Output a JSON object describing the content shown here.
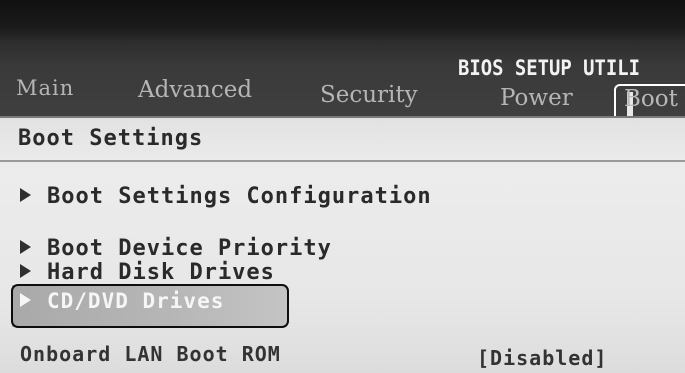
{
  "header": {
    "title": "BIOS SETUP UTILI",
    "tabs": [
      {
        "label": "Main"
      },
      {
        "label": "Advanced"
      },
      {
        "label": "Security"
      },
      {
        "label": "Power"
      },
      {
        "label": "Boot"
      }
    ],
    "active_tab": "Boot"
  },
  "section": {
    "title": "Boot Settings"
  },
  "menu": {
    "items": [
      {
        "label": "Boot Settings Configuration"
      },
      {
        "label": "Boot Device Priority"
      },
      {
        "label": "Hard Disk Drives"
      },
      {
        "label": "CD/DVD Drives"
      }
    ],
    "selected": "CD/DVD Drives"
  },
  "settings": {
    "onboard_lan_label": "Onboard LAN Boot ROM",
    "onboard_lan_value": "[Disabled]"
  },
  "icons": {
    "submenu_arrow": "triangle-right-icon"
  },
  "colors": {
    "header_band": "#3a3a3a",
    "content_bg": "#ececec",
    "text": "#2a2a2a",
    "highlight_text": "#f6f6f6"
  }
}
